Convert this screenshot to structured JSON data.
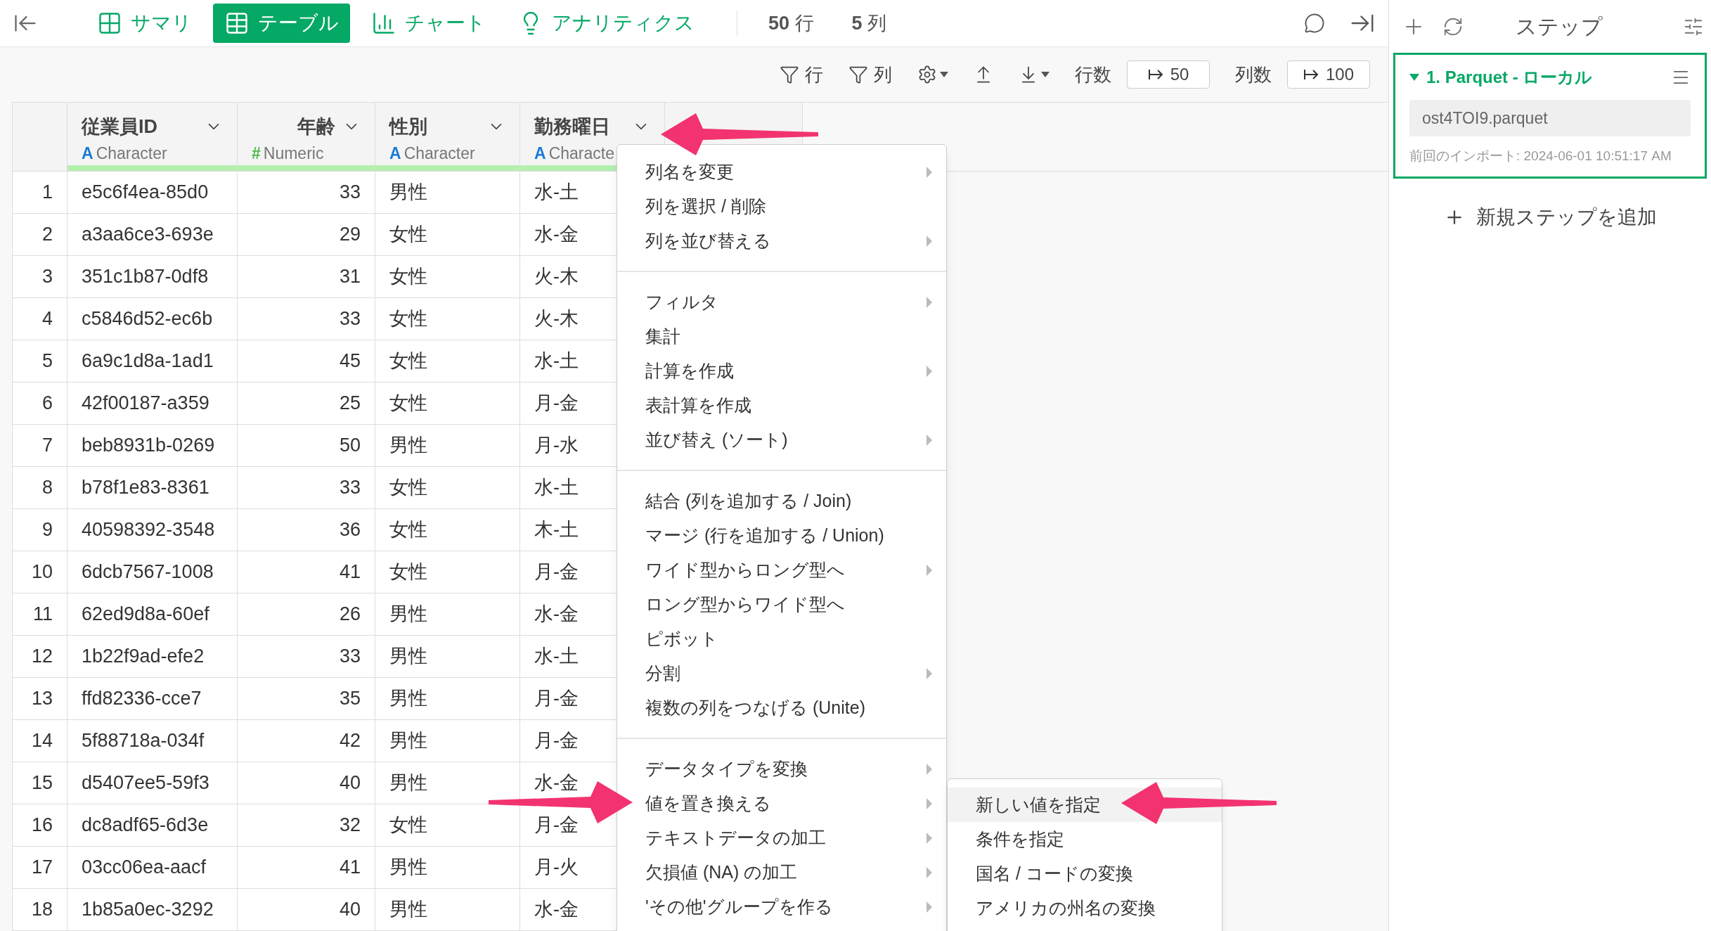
{
  "nav": {
    "tabs": [
      {
        "label": "サマリ",
        "kind": "summary",
        "selected": false
      },
      {
        "label": "テーブル",
        "kind": "table",
        "selected": true
      },
      {
        "label": "チャート",
        "kind": "chart",
        "selected": false
      },
      {
        "label": "アナリティクス",
        "kind": "analytics",
        "selected": false
      }
    ],
    "counts": [
      {
        "value": "50",
        "unit": "行"
      },
      {
        "value": "5",
        "unit": "列"
      }
    ]
  },
  "toolbar": {
    "row_filter": "行",
    "column_filter": "列",
    "row_count_label": "行数",
    "row_count": "50",
    "column_count_label": "列数",
    "column_count": "100"
  },
  "table": {
    "columns": [
      {
        "kind": "index"
      },
      {
        "name": "従業員ID",
        "type_icon": "A",
        "type": "Character",
        "kind": "character"
      },
      {
        "name": "年齢",
        "type_icon": "#",
        "type": "Numeric",
        "kind": "numeric"
      },
      {
        "name": "性別",
        "type_icon": "A",
        "type": "Character",
        "kind": "character"
      },
      {
        "name": "勤務曜日",
        "type_icon": "A",
        "type": "Characte",
        "kind": "character"
      }
    ],
    "rows": [
      [
        "1",
        "e5c6f4ea-85d0",
        "33",
        "男性",
        "水-土"
      ],
      [
        "2",
        "a3aa6ce3-693e",
        "29",
        "女性",
        "水-金"
      ],
      [
        "3",
        "351c1b87-0df8",
        "31",
        "女性",
        "火-木"
      ],
      [
        "4",
        "c5846d52-ec6b",
        "33",
        "女性",
        "火-木"
      ],
      [
        "5",
        "6a9c1d8a-1ad1",
        "45",
        "女性",
        "水-土"
      ],
      [
        "6",
        "42f00187-a359",
        "25",
        "女性",
        "月-金"
      ],
      [
        "7",
        "beb8931b-0269",
        "50",
        "男性",
        "月-水"
      ],
      [
        "8",
        "b78f1e83-8361",
        "33",
        "女性",
        "水-土"
      ],
      [
        "9",
        "40598392-3548",
        "36",
        "女性",
        "木-土"
      ],
      [
        "10",
        "6dcb7567-1008",
        "41",
        "女性",
        "月-金"
      ],
      [
        "11",
        "62ed9d8a-60ef",
        "26",
        "男性",
        "水-金"
      ],
      [
        "12",
        "1b22f9ad-efe2",
        "33",
        "男性",
        "水-土"
      ],
      [
        "13",
        "ffd82336-cce7",
        "35",
        "男性",
        "月-金"
      ],
      [
        "14",
        "5f88718a-034f",
        "42",
        "男性",
        "月-金"
      ],
      [
        "15",
        "d5407ee5-59f3",
        "40",
        "男性",
        "水-金"
      ],
      [
        "16",
        "dc8adf65-6d3e",
        "32",
        "女性",
        "月-金"
      ],
      [
        "17",
        "03cc06ea-aacf",
        "41",
        "男性",
        "月-火"
      ],
      [
        "18",
        "1b85a0ec-3292",
        "40",
        "男性",
        "水-金"
      ]
    ]
  },
  "context_menu": {
    "sections": [
      [
        {
          "label": "列名を変更",
          "submenu": true
        },
        {
          "label": "列を選択 / 削除",
          "submenu": false
        },
        {
          "label": "列を並び替える",
          "submenu": true
        }
      ],
      [
        {
          "label": "フィルタ",
          "submenu": true
        },
        {
          "label": "集計",
          "submenu": false
        },
        {
          "label": "計算を作成",
          "submenu": true
        },
        {
          "label": "表計算を作成",
          "submenu": false
        },
        {
          "label": "並び替え (ソート)",
          "submenu": true
        }
      ],
      [
        {
          "label": "結合 (列を追加する / Join)",
          "submenu": false
        },
        {
          "label": "マージ (行を追加する / Union)",
          "submenu": false
        },
        {
          "label": "ワイド型からロング型へ",
          "submenu": true
        },
        {
          "label": "ロング型からワイド型へ",
          "submenu": false
        },
        {
          "label": "ピボット",
          "submenu": false
        },
        {
          "label": "分割",
          "submenu": true
        },
        {
          "label": "複数の列をつなげる (Unite)",
          "submenu": false
        }
      ],
      [
        {
          "label": "データタイプを変換",
          "submenu": true
        },
        {
          "label": "値を置き換える",
          "submenu": true
        },
        {
          "label": "テキストデータの加工",
          "submenu": true
        },
        {
          "label": "欠損値 (NA) の加工",
          "submenu": true
        },
        {
          "label": "'その他'グループを作る",
          "submenu": true
        }
      ]
    ],
    "submenu": [
      {
        "label": "新しい値を指定",
        "selected": true
      },
      {
        "label": "条件を指定",
        "selected": false
      },
      {
        "label": "国名 / コードの変換",
        "selected": false
      },
      {
        "label": "アメリカの州名の変換",
        "selected": false
      }
    ]
  },
  "steps_panel": {
    "title": "ステップ",
    "steps": [
      {
        "title": "1. Parquet - ローカル",
        "expanded": true,
        "file": "ost4TOI9.parquet",
        "last_import": "前回のインポート: 2024-06-01 10:51:17 AM"
      }
    ],
    "add_step": "新規ステップを追加"
  }
}
